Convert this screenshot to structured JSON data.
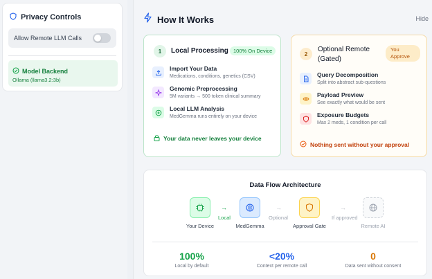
{
  "sidebar": {
    "title": "Privacy Controls",
    "toggle_label": "Allow Remote LLM Calls",
    "backend": {
      "title": "Model Backend",
      "subtitle": "Ollama (llama3.2:3b)"
    }
  },
  "main": {
    "title": "How It Works",
    "hide_label": "Hide",
    "local": {
      "number": "1",
      "title": "Local Processing",
      "badge": "100% On Device",
      "features": [
        {
          "title": "Import Your Data",
          "subtitle": "Medications, conditions, genetics (CSV)",
          "icon": "upload-icon"
        },
        {
          "title": "Genomic Preprocessing",
          "subtitle": "5M variants → 500 token clinical summary",
          "icon": "sparkle-icon"
        },
        {
          "title": "Local LLM Analysis",
          "subtitle": "MedGemma runs entirely on your device",
          "icon": "chip-icon"
        }
      ],
      "footer": "Your data never leaves your device"
    },
    "remote": {
      "number": "2",
      "title": "Optional Remote (Gated)",
      "badge": "You Approve",
      "features": [
        {
          "title": "Query Decomposition",
          "subtitle": "Split into abstract sub-questions",
          "icon": "document-icon"
        },
        {
          "title": "Payload Preview",
          "subtitle": "See exactly what would be sent",
          "icon": "eye-icon"
        },
        {
          "title": "Exposure Budgets",
          "subtitle": "Max 2 meds, 1 condition per call",
          "icon": "shield-icon"
        }
      ],
      "footer": "Nothing sent without your approval"
    },
    "architecture": {
      "title": "Data Flow Architecture",
      "nodes": [
        {
          "label": "Your Device",
          "icon": "chip-icon"
        },
        {
          "label": "MedGemma",
          "icon": "brain-icon"
        },
        {
          "label": "Approval Gate",
          "icon": "shield-icon"
        },
        {
          "label": "Remote AI",
          "icon": "globe-icon"
        }
      ],
      "arrows": [
        "Local",
        "Optional",
        "If approved"
      ],
      "stats": [
        {
          "value": "100%",
          "label": "Local by default"
        },
        {
          "value": "<20%",
          "label": "Context per remote call"
        },
        {
          "value": "0",
          "label": "Data sent without consent"
        }
      ]
    }
  },
  "colors": {
    "green": "#16a34a",
    "blue": "#2563eb",
    "amber": "#d97706",
    "gray": "#9ca3af"
  }
}
